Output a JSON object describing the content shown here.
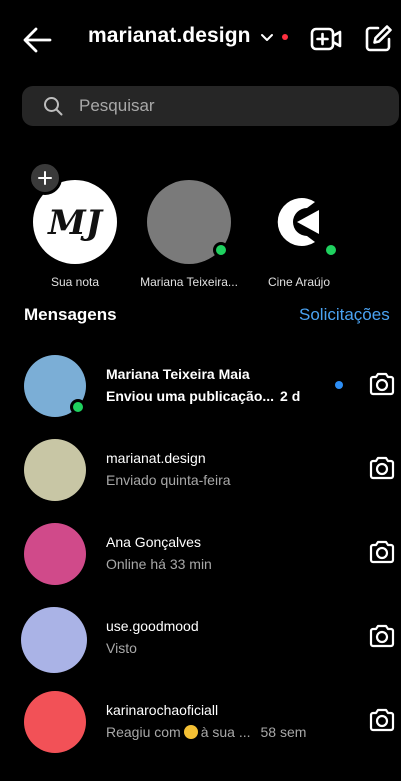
{
  "header": {
    "account_name": "marianat.design"
  },
  "search": {
    "placeholder": "Pesquisar"
  },
  "notes": [
    {
      "label": "Sua nota",
      "logo_text": "MJ"
    },
    {
      "label": "Mariana Teixeira...",
      "avatar_color": "#7a7a7a",
      "online": true
    },
    {
      "label": "Cine Araújo",
      "online": true
    }
  ],
  "messages_section": {
    "title": "Mensagens",
    "requests_label": "Solicitações"
  },
  "conversations": [
    {
      "name": "Mariana Teixeira Maia",
      "subtitle": "Enviou uma publicação...",
      "time": "2 d",
      "unread": true,
      "online": true,
      "avatar_color": "#7baed6"
    },
    {
      "name": "marianat.design",
      "subtitle": "Enviado quinta-feira",
      "time": "",
      "unread": false,
      "avatar_color": "#c8c6a5"
    },
    {
      "name": "Ana Gonçalves",
      "subtitle": "Online há 33 min",
      "time": "",
      "unread": false,
      "avatar_color": "#d04a8a"
    },
    {
      "name": "use.goodmood",
      "subtitle": "Visto",
      "time": "",
      "unread": false,
      "avatar_color": "#aab3e6"
    },
    {
      "name": "karinarochaoficiall",
      "subtitle_before": "Reagiu com",
      "subtitle_after": "à sua ...",
      "time": "58 sem",
      "unread": false,
      "avatar_color": "#f25157"
    }
  ],
  "colors": {
    "accent_blue": "#4ba3f2",
    "online_green": "#1fd15f",
    "notification_red": "#ff3040"
  }
}
